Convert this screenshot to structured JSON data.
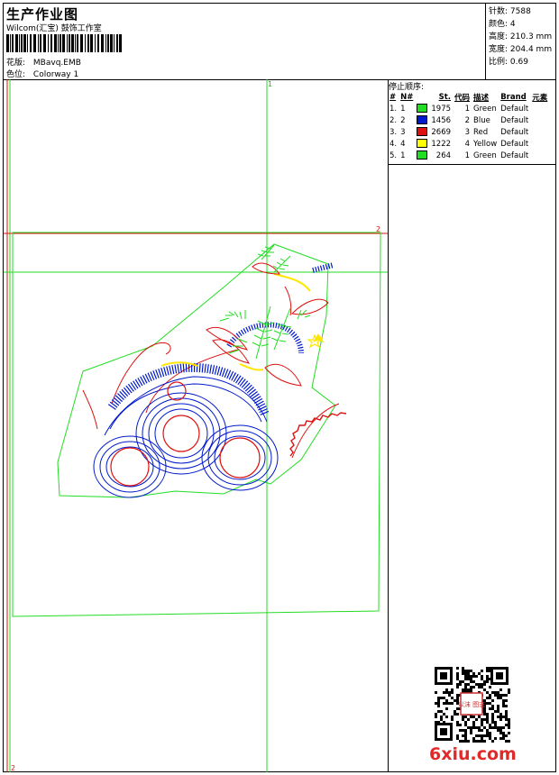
{
  "header": {
    "title": "生产作业图",
    "company": "Wilcom(汇宝) 鼓饰工作室",
    "design_label": "花版:",
    "design_value": "MBavq.EMB",
    "color_label": "色位:",
    "color_value": "Colorway 1"
  },
  "stats": {
    "stitches_label": "针数:",
    "stitches": "7588",
    "colors_label": "颜色:",
    "colors": "4",
    "height_label": "高度:",
    "height": "210.3 mm",
    "width_label": "宽度:",
    "width": "204.4 mm",
    "scale_label": "比例:",
    "scale": "0.69"
  },
  "stop_sequence": {
    "title": "停止顺序:",
    "headers": [
      "#",
      "N#",
      "",
      "St.",
      "代码",
      "描述",
      "Brand",
      "元素"
    ],
    "rows": [
      {
        "idx": "1.",
        "n": "1",
        "color": "#22dd22",
        "st": "1975",
        "code": "1",
        "desc": "Green",
        "brand": "Default"
      },
      {
        "idx": "2.",
        "n": "2",
        "color": "#0018cc",
        "st": "1456",
        "code": "2",
        "desc": "Blue",
        "brand": "Default"
      },
      {
        "idx": "3.",
        "n": "3",
        "color": "#dd1111",
        "st": "2669",
        "code": "3",
        "desc": "Red",
        "brand": "Default"
      },
      {
        "idx": "4.",
        "n": "4",
        "color": "#ffff00",
        "st": "1222",
        "code": "4",
        "desc": "Yellow",
        "brand": "Default"
      },
      {
        "idx": "5.",
        "n": "1",
        "color": "#22dd22",
        "st": "264",
        "code": "1",
        "desc": "Green",
        "brand": "Default"
      }
    ]
  },
  "guides": {
    "v1_label": "1",
    "h2_label": "2",
    "corner_label": "2"
  },
  "watermark": "6xiu.com",
  "qr_stamp": "以沫 图志"
}
